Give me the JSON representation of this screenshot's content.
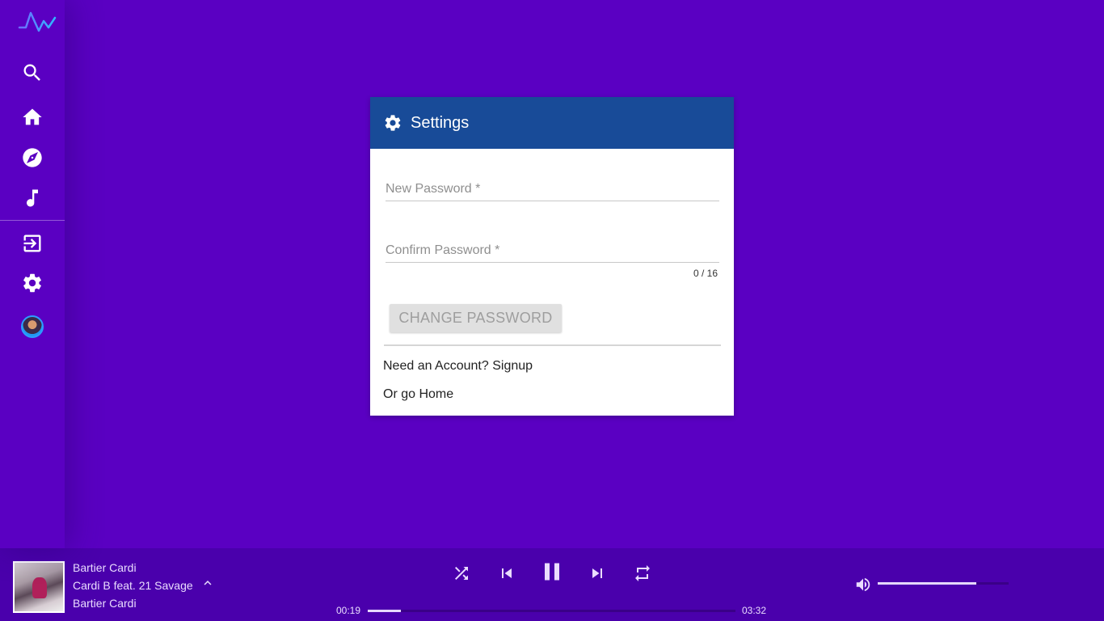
{
  "sidebar": {
    "logo_icon": "pulse-logo-icon",
    "items": [
      {
        "name": "search",
        "icon": "search-icon"
      },
      {
        "name": "home",
        "icon": "home-icon"
      },
      {
        "name": "explore",
        "icon": "compass-icon"
      },
      {
        "name": "library",
        "icon": "music-note-icon"
      },
      {
        "name": "login",
        "icon": "login-icon"
      },
      {
        "name": "settings",
        "icon": "gear-icon"
      },
      {
        "name": "profile",
        "icon": "avatar"
      }
    ]
  },
  "settings_card": {
    "title": "Settings",
    "title_icon": "gear-icon",
    "new_password": {
      "placeholder": "New Password *",
      "value": ""
    },
    "confirm_password": {
      "placeholder": "Confirm Password *",
      "value": ""
    },
    "char_counter": "0 / 16",
    "change_button_label": "CHANGE PASSWORD",
    "signup_link": "Need an Account? Signup",
    "home_link": "Or go Home"
  },
  "player": {
    "track_title": "Bartier Cardi",
    "artist": "Cardi B feat. 21 Savage",
    "album": "Bartier Cardi",
    "elapsed": "00:19",
    "duration": "03:32",
    "progress_fraction": 0.09,
    "volume_fraction": 0.75,
    "controls": [
      "shuffle-icon",
      "skip-previous-icon",
      "pause-icon",
      "skip-next-icon",
      "repeat-icon"
    ]
  },
  "colors": {
    "background": "#5a00c2",
    "card_header": "#184b98",
    "player_bar": "#4a00ac"
  }
}
